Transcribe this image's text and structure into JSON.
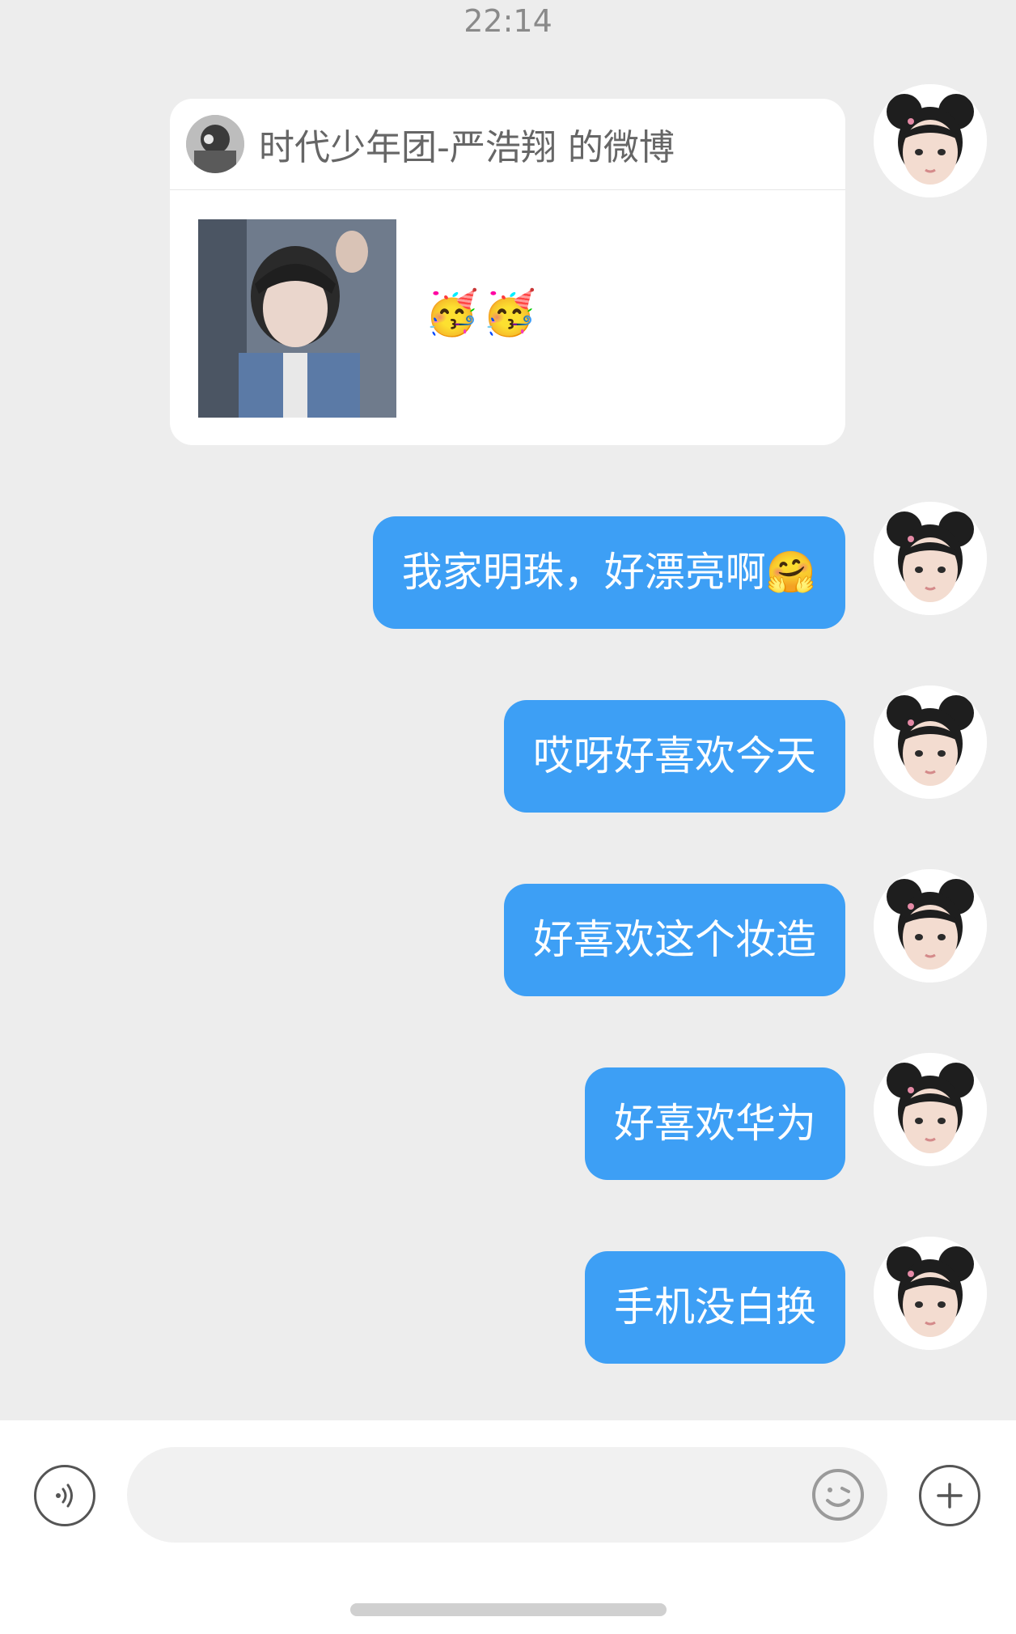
{
  "header": {
    "time": "22:14"
  },
  "shared_card": {
    "title": "时代少年团-严浩翔 的微博",
    "emoji": "🥳🥳"
  },
  "messages": [
    {
      "text": "我家明珠，好漂亮啊🤗"
    },
    {
      "text": "哎呀好喜欢今天"
    },
    {
      "text": "好喜欢这个妆造"
    },
    {
      "text": "好喜欢华为"
    },
    {
      "text": "手机没白换"
    }
  ],
  "input": {
    "placeholder": ""
  },
  "icons": {
    "voice": "voice-icon",
    "emoji": "emoji-icon",
    "plus": "plus-icon"
  },
  "colors": {
    "bubble": "#3d9ff5",
    "background": "#ededed"
  }
}
